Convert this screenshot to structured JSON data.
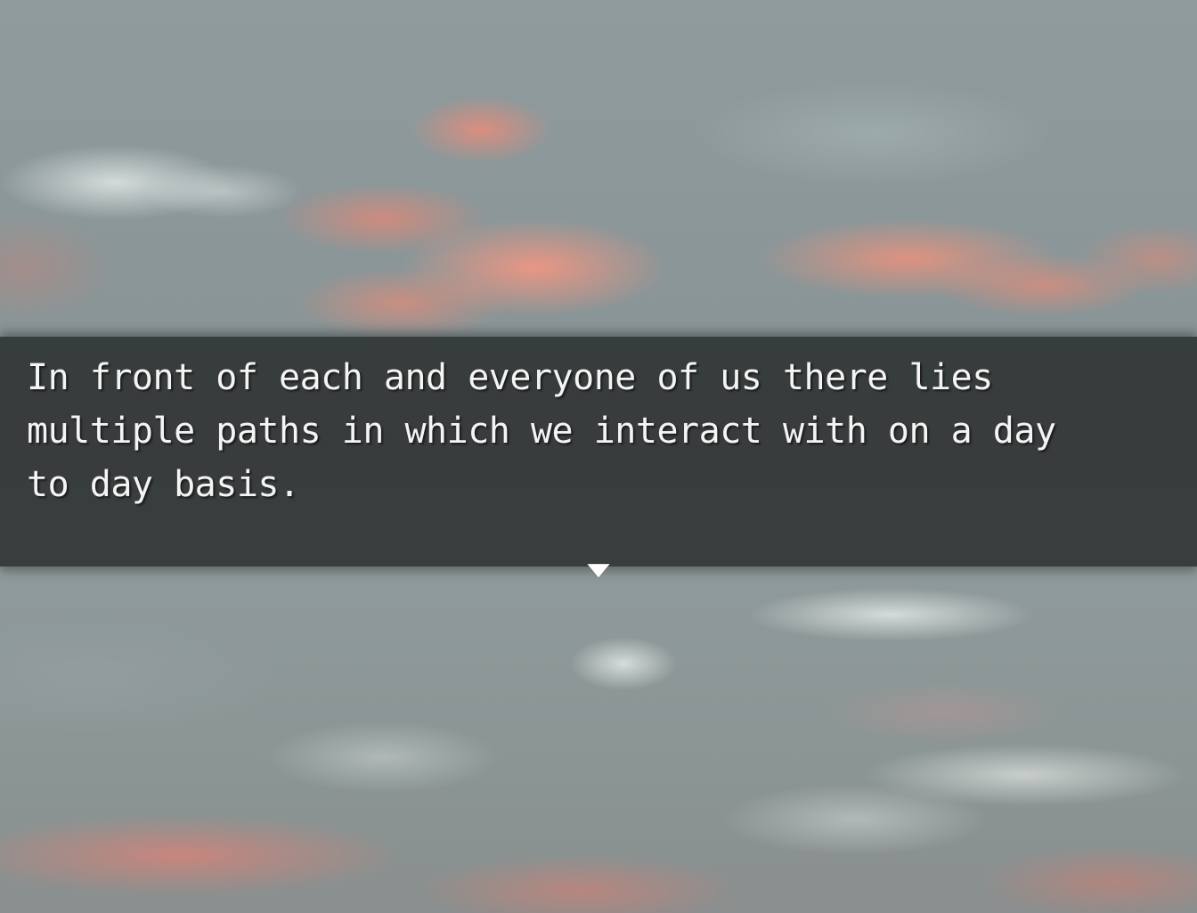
{
  "dialog": {
    "lines": [
      "In front of each and everyone of us there lies",
      "multiple paths in which we interact with on a day",
      "to day basis."
    ]
  },
  "advance_indicator": {
    "icon": "down-triangle-icon"
  },
  "colors": {
    "dialog_background": "#202223",
    "text": "#f4f4f4",
    "cloud_pink": "#ee9682",
    "sky_gray": "#8f9b9d"
  }
}
